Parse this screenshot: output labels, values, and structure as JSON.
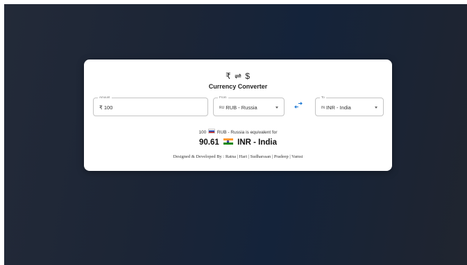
{
  "header": {
    "symbols": "₹ ⇌ $",
    "title": "Currency Converter"
  },
  "amount": {
    "label": "Amount",
    "prefix": "₹",
    "value": "100"
  },
  "from": {
    "label": "From",
    "code": "RU",
    "value": "RUB - Russia"
  },
  "to": {
    "label": "To",
    "code": "IN",
    "value": "INR - India"
  },
  "swap_icon": "swap-arrows-icon",
  "result": {
    "amount": "100",
    "from_text": "RUB - Russia is equivalent for",
    "converted_value": "90.61",
    "to_text": "INR - India"
  },
  "footer": {
    "credits": "Designed & Developed By : Ratna | Hari | Sudharssan | Pradeep | Vamsi"
  },
  "colors": {
    "background": "#1c2536",
    "card": "#ffffff",
    "swap_accent": "#1976d2"
  }
}
